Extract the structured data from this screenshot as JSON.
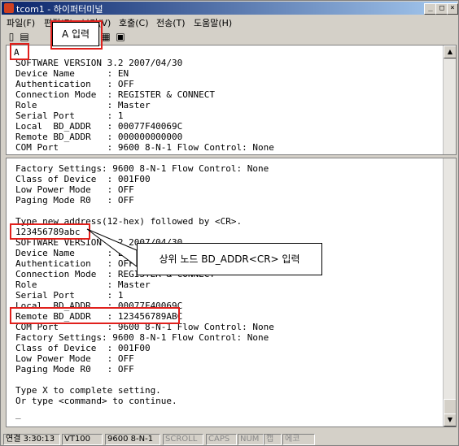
{
  "window": {
    "title": "tcom1 - 하이퍼터미널",
    "min_label": "_",
    "max_label": "□",
    "close_label": "×"
  },
  "menu": [
    "파일(F)",
    "편집(E)",
    "보기(V)",
    "호출(C)",
    "전송(T)",
    "도움말(H)"
  ],
  "terminal_top": {
    "lines": [
      "A",
      "SOFTWARE VERSION 3.2 2007/04/30",
      "Device Name      : EN",
      "Authentication   : OFF",
      "Connection Mode  : REGISTER & CONNECT",
      "Role             : Master",
      "Serial Port      : 1",
      "Local  BD_ADDR   : 00077F40069C",
      "Remote BD_ADDR   : 000000000000",
      "COM Port         : 9600 8-N-1 Flow Control: None"
    ]
  },
  "terminal_bottom": {
    "lines": [
      "Factory Settings: 9600 8-N-1 Flow Control: None",
      "Class of Device  : 001F00",
      "Low Power Mode   : OFF",
      "Paging Mode R0   : OFF",
      "",
      "Type new address(12-hex) followed by <CR>.",
      "123456789abc",
      "SOFTWARE VERSION 3.2 2007/04/30",
      "Device Name      : EN",
      "Authentication   : OFF",
      "Connection Mode  : REGISTER & CONNECT",
      "Role             : Master",
      "Serial Port      : 1",
      "Local  BD_ADDR   : 00077F40069C",
      "Remote BD_ADDR   : 123456789ABC",
      "COM Port         : 9600 8-N-1 Flow Control: None",
      "Factory Settings: 9600 8-N-1 Flow Control: None",
      "Class of Device  : 001F00",
      "Low Power Mode   : OFF",
      "Paging Mode R0   : OFF",
      "",
      "Type X to complete setting.",
      "Or type <command> to continue.",
      "",
      "_"
    ]
  },
  "annotations": {
    "input_a": "A 입력",
    "upper_node": "상위 노드 BD_ADDR<CR> 입력"
  },
  "status": {
    "connected": "연결 3:30:13",
    "terminal": "VT100",
    "settings": "9600 8-N-1",
    "scroll": "SCROLL",
    "caps": "CAPS",
    "num": "NUM",
    "capture": "캡",
    "echo": "에코"
  },
  "colors": {
    "annotation_red": "#e0201c",
    "title_gradient_start": "#0a246a"
  }
}
